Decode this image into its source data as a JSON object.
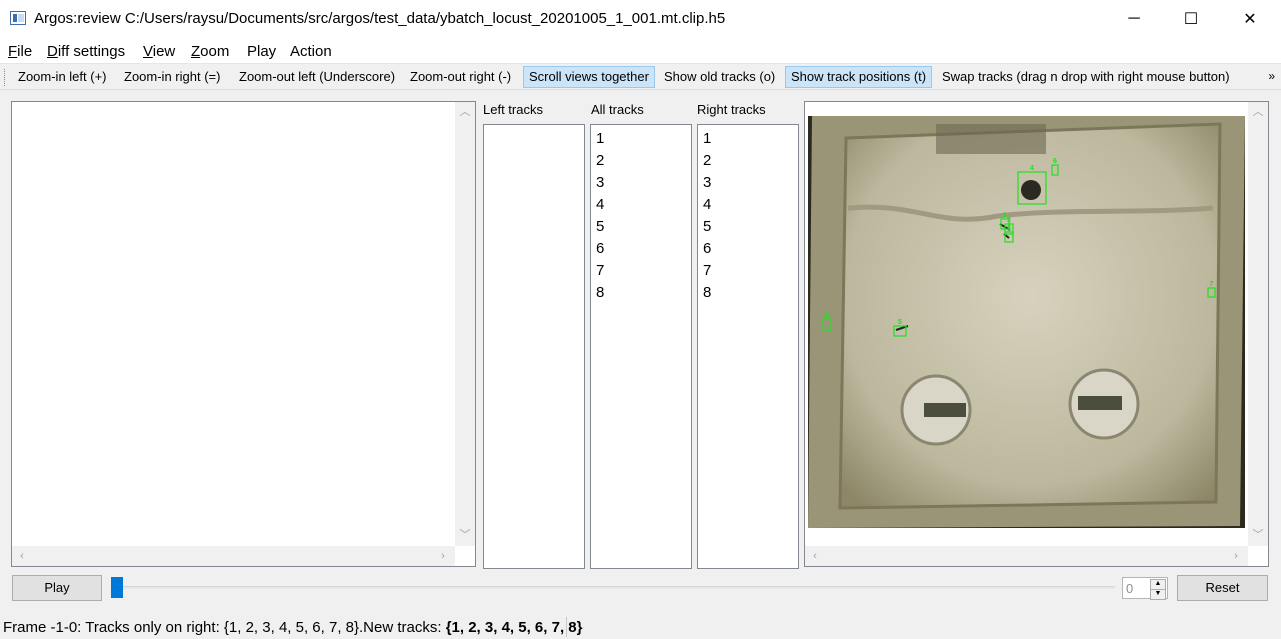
{
  "window": {
    "title": "Argos:review C:/Users/raysu/Documents/src/argos/test_data/ybatch_locust_20201005_1_001.mt.clip.h5",
    "minimize_glyph": "─",
    "maximize_glyph": "☐",
    "close_glyph": "✕"
  },
  "menubar": {
    "file": {
      "first": "F",
      "rest": "ile"
    },
    "diff": {
      "first": "D",
      "rest": "iff settings"
    },
    "view": {
      "first": "V",
      "rest": "iew"
    },
    "zoom": {
      "first": "Z",
      "rest": "oom"
    },
    "play": {
      "first": "",
      "rest": "Play"
    },
    "action": {
      "first": "",
      "rest": "Action"
    }
  },
  "toolbar": {
    "zoom_in_left": "Zoom-in left (+)",
    "zoom_in_right": "Zoom-in right (=)",
    "zoom_out_left": "Zoom-out left (Underscore)",
    "zoom_out_right": "Zoom-out right (-)",
    "scroll_together": "Scroll views together",
    "show_old_tracks": "Show old tracks (o)",
    "show_track_positions": "Show track positions (t)",
    "swap_tracks": "Swap tracks (drag n drop with right mouse button)",
    "more": "»"
  },
  "lists": {
    "left": {
      "label": "Left tracks",
      "items": []
    },
    "all": {
      "label": "All tracks",
      "items": [
        "1",
        "2",
        "3",
        "4",
        "5",
        "6",
        "7",
        "8"
      ]
    },
    "right": {
      "label": "Right tracks",
      "items": [
        "1",
        "2",
        "3",
        "4",
        "5",
        "6",
        "7",
        "8"
      ]
    }
  },
  "frame_tracks": [
    {
      "id": "1",
      "color": "#22e022"
    },
    {
      "id": "2",
      "color": "#22e022"
    },
    {
      "id": "3",
      "color": "#22e022"
    },
    {
      "id": "4",
      "color": "#22e022"
    },
    {
      "id": "5",
      "color": "#22e022"
    },
    {
      "id": "6",
      "color": "#22e022"
    },
    {
      "id": "7",
      "color": "#22e022"
    },
    {
      "id": "8",
      "color": "#22e022"
    }
  ],
  "controls": {
    "play_label": "Play",
    "frame_spin_value": "0",
    "reset_label": "Reset"
  },
  "status": {
    "prefix": "Frame -1-0: Tracks only on right: {1, 2, 3, 4, 5, 6, 7, 8}.New tracks: ",
    "new_tracks": "{1, 2, 3, 4, 5, 6, 7, 8}"
  },
  "colors": {
    "accent": "#0078d7",
    "toggle_on": "#cce4f7",
    "track_box": "#22e022"
  }
}
